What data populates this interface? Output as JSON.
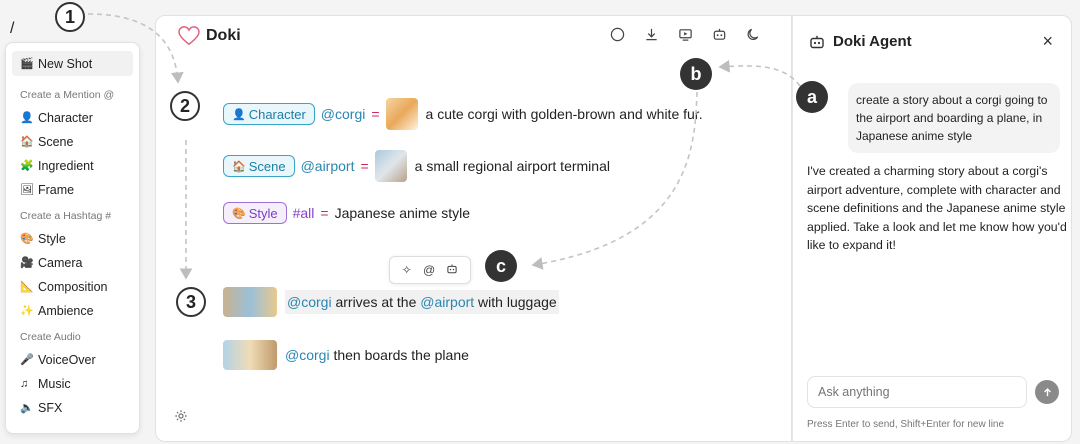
{
  "slash": "/",
  "callouts": {
    "one": "1",
    "two": "2",
    "three": "3",
    "a": "a",
    "b": "b",
    "c": "c"
  },
  "menu": {
    "new_shot": {
      "icon": "clapperboard-icon",
      "label": "New Shot"
    },
    "groups": [
      {
        "title": "Create a Mention @",
        "items": [
          {
            "icon": "person-icon",
            "label": "Character"
          },
          {
            "icon": "scene-icon",
            "label": "Scene"
          },
          {
            "icon": "puzzle-icon",
            "label": "Ingredient"
          },
          {
            "icon": "frame-icon",
            "label": "Frame"
          }
        ]
      },
      {
        "title": "Create a Hashtag #",
        "items": [
          {
            "icon": "palette-icon",
            "label": "Style"
          },
          {
            "icon": "camera-icon",
            "label": "Camera"
          },
          {
            "icon": "ruler-icon",
            "label": "Composition"
          },
          {
            "icon": "sparkle-icon",
            "label": "Ambience"
          }
        ]
      },
      {
        "title": "Create Audio",
        "items": [
          {
            "icon": "microphone-icon",
            "label": "VoiceOver"
          },
          {
            "icon": "music-note-icon",
            "label": "Music"
          },
          {
            "icon": "speaker-icon",
            "label": "SFX"
          }
        ]
      }
    ]
  },
  "editor": {
    "brand": "Doki",
    "toolbar_icons": [
      "circle-icon",
      "download-icon",
      "present-icon",
      "bot-icon",
      "moon-icon"
    ],
    "definitions": {
      "character": {
        "chip": "Character",
        "mention": "@corgi",
        "eq": "=",
        "text": "a cute corgi with golden-brown and white fur."
      },
      "scene": {
        "chip": "Scene",
        "mention": "@airport",
        "eq": "=",
        "text": "a small regional airport terminal"
      },
      "style": {
        "chip": "Style",
        "hashtag": "#all",
        "eq": "=",
        "text": "Japanese anime style"
      }
    },
    "float_toolbar": [
      "magic-icon",
      "at-icon",
      "bot-icon"
    ],
    "shots": [
      {
        "mention1": "@corgi",
        "text1": " arrives at the ",
        "mention2": "@airport",
        "text2": " with luggage"
      },
      {
        "mention1": "@corgi",
        "text1": " then boards the plane"
      }
    ]
  },
  "agent": {
    "title": "Doki Agent",
    "close": "×",
    "user_message": "create a story about a corgi going to the airport and boarding a plane, in Japanese anime style",
    "reply": "I've created a charming story about a corgi's airport adventure, complete with character and scene definitions and the Japanese anime style applied. Take a look and let me know how you'd like to expand it!",
    "input_placeholder": "Ask anything",
    "hint": "Press Enter to send, Shift+Enter for new line"
  },
  "colors": {
    "mention": "#2a86b0",
    "hashtag": "#8a3fc9",
    "equals": "#d12a5c",
    "chip_cyan": "#39a5c7",
    "chip_purple": "#a070d9"
  }
}
